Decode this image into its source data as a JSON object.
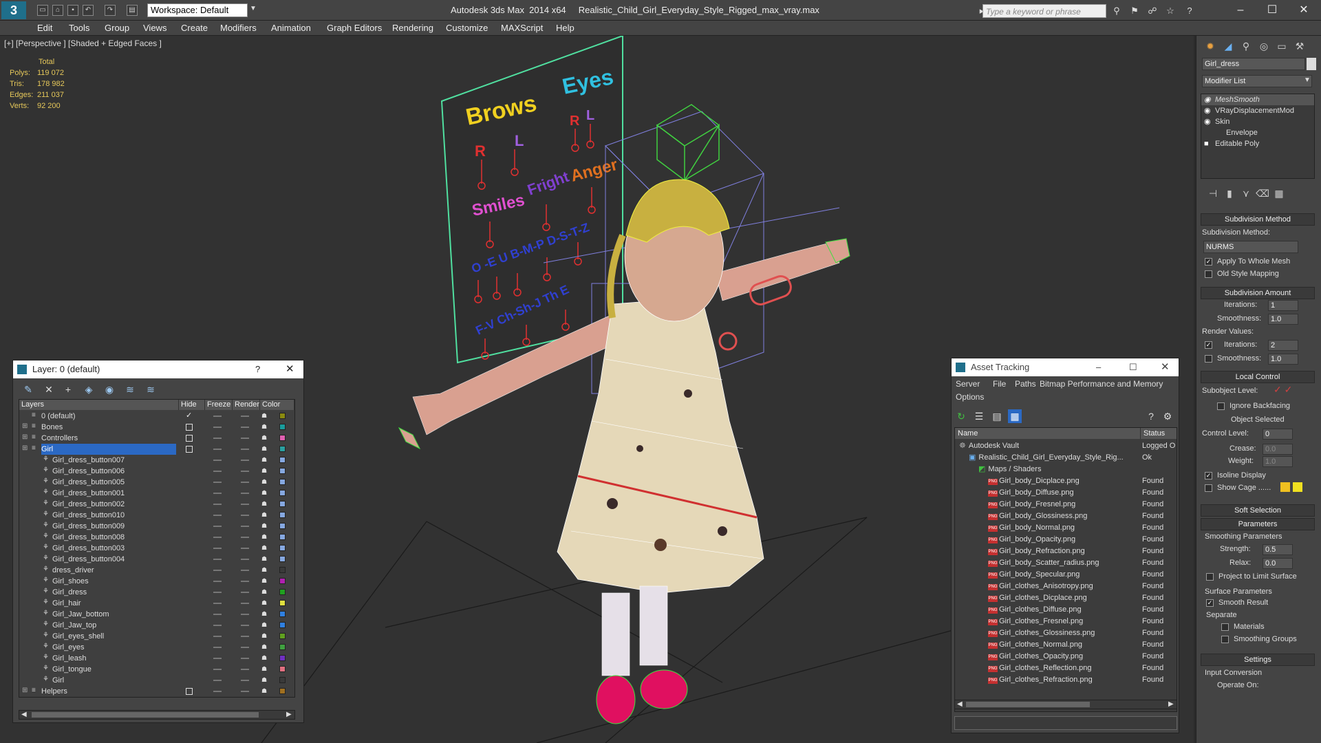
{
  "titlebar": {
    "app_logo": "3",
    "workspace": "Workspace: Default",
    "app_name": "Autodesk 3ds Max  2014 x64",
    "file_name": "Realistic_Child_Girl_Everyday_Style_Rigged_max_vray.max",
    "search_placeholder": "Type a keyword or phrase"
  },
  "menu": [
    "Edit",
    "Tools",
    "Group",
    "Views",
    "Create",
    "Modifiers",
    "Animation",
    "Graph Editors",
    "Rendering",
    "Customize",
    "MAXScript",
    "Help"
  ],
  "viewport": {
    "label": "[+] [Perspective ] [Shaded + Edged Faces ]",
    "stats_header": "Total",
    "stats": [
      {
        "label": "Polys:",
        "value": "119 072"
      },
      {
        "label": "Tris:",
        "value": "178 982"
      },
      {
        "label": "Edges:",
        "value": "211 037"
      },
      {
        "label": "Verts:",
        "value": "92 200"
      }
    ],
    "board_labels": {
      "brows": "Brows",
      "eyes": "Eyes",
      "r": "R",
      "l": "L",
      "smiles": "Smiles",
      "fright": "Fright",
      "anger": "Anger",
      "phonemes": "O  -E  U  B-M-P  D-S-T-Z",
      "phonemes2": "F-V  Ch-Sh-J  Th  E"
    }
  },
  "command_panel": {
    "object_name": "Girl_dress",
    "modifier_list": "Modifier List",
    "stack": [
      {
        "label": "MeshSmooth",
        "selected": true
      },
      {
        "label": "VRayDisplacementMod",
        "selected": false
      },
      {
        "label": "Skin",
        "selected": false
      },
      {
        "label": "Envelope",
        "selected": false
      },
      {
        "label": "Editable Poly",
        "selected": false
      }
    ],
    "subdivision_method_head": "Subdivision Method",
    "subdivision_method_label": "Subdivision Method:",
    "subdivision_method_value": "NURMS",
    "apply_whole_mesh": "Apply To Whole Mesh",
    "old_style_mapping": "Old Style Mapping",
    "subdivision_amount_head": "Subdivision Amount",
    "iterations_label": "Iterations:",
    "iterations_value": "1",
    "smoothness_label": "Smoothness:",
    "smoothness_value": "1.0",
    "render_values": "Render Values:",
    "render_iterations_label": "Iterations:",
    "render_iterations_value": "2",
    "render_smoothness_label": "Smoothness:",
    "render_smoothness_value": "1.0",
    "local_control_head": "Local Control",
    "subobject_level": "Subobject Level:",
    "ignore_backfacing": "Ignore Backfacing",
    "object_selected": "Object Selected",
    "control_level_label": "Control Level:",
    "control_level_value": "0",
    "crease_label": "Crease:",
    "crease_value": "0.0",
    "weight_label": "Weight:",
    "weight_value": "1.0",
    "isoline_display": "Isoline Display",
    "show_cage": "Show Cage ......",
    "soft_selection_head": "Soft Selection",
    "parameters_head": "Parameters",
    "smoothing_params": "Smoothing Parameters",
    "strength_label": "Strength:",
    "strength_value": "0.5",
    "relax_label": "Relax:",
    "relax_value": "0.0",
    "project_limit": "Project to Limit Surface",
    "surface_params": "Surface Parameters",
    "smooth_result": "Smooth Result",
    "separate": "Separate",
    "materials": "Materials",
    "smoothing_groups": "Smoothing Groups",
    "settings_head": "Settings",
    "input_conversion": "Input Conversion",
    "operate_on": "Operate On:"
  },
  "layer_dialog": {
    "title": "Layer: 0 (default)",
    "help": "?",
    "columns": [
      "Layers",
      "Hide",
      "Freeze",
      "Render",
      "Color"
    ],
    "rows": [
      {
        "name": "0 (default)",
        "level": 0,
        "check": true,
        "color": "#8a8a10"
      },
      {
        "name": "Bones",
        "level": 0,
        "expand": true,
        "box": true,
        "color": "#1a9c9c"
      },
      {
        "name": "Controllers",
        "level": 0,
        "expand": true,
        "box": true,
        "color": "#e060b0"
      },
      {
        "name": "Girl",
        "level": 0,
        "expand": true,
        "box": true,
        "selected": true,
        "color": "#2aa0a0"
      },
      {
        "name": "Girl_dress_button007",
        "level": 1,
        "color": "#86a8e0"
      },
      {
        "name": "Girl_dress_button006",
        "level": 1,
        "color": "#86a8e0"
      },
      {
        "name": "Girl_dress_button005",
        "level": 1,
        "color": "#86a8e0"
      },
      {
        "name": "Girl_dress_button001",
        "level": 1,
        "color": "#86a8e0"
      },
      {
        "name": "Girl_dress_button002",
        "level": 1,
        "color": "#86a8e0"
      },
      {
        "name": "Girl_dress_button010",
        "level": 1,
        "color": "#86a8e0"
      },
      {
        "name": "Girl_dress_button009",
        "level": 1,
        "color": "#86a8e0"
      },
      {
        "name": "Girl_dress_button008",
        "level": 1,
        "color": "#86a8e0"
      },
      {
        "name": "Girl_dress_button003",
        "level": 1,
        "color": "#86a8e0"
      },
      {
        "name": "Girl_dress_button004",
        "level": 1,
        "color": "#86a8e0"
      },
      {
        "name": "dress_driver",
        "level": 1,
        "color": "#3a3a3a"
      },
      {
        "name": "Girl_shoes",
        "level": 1,
        "color": "#b020b0"
      },
      {
        "name": "Girl_dress",
        "level": 1,
        "color": "#20a020"
      },
      {
        "name": "Girl_hair",
        "level": 1,
        "color": "#e0e040"
      },
      {
        "name": "Girl_Jaw_bottom",
        "level": 1,
        "color": "#3080e0"
      },
      {
        "name": "Girl_Jaw_top",
        "level": 1,
        "color": "#3080e0"
      },
      {
        "name": "Girl_eyes_shell",
        "level": 1,
        "color": "#60a020"
      },
      {
        "name": "Girl_eyes",
        "level": 1,
        "color": "#40a040"
      },
      {
        "name": "Girl_leash",
        "level": 1,
        "color": "#7030c0"
      },
      {
        "name": "Girl_tongue",
        "level": 1,
        "color": "#e07080"
      },
      {
        "name": "Girl",
        "level": 1,
        "color": "#3a3a3a"
      },
      {
        "name": "Helpers",
        "level": 0,
        "expand": true,
        "box": true,
        "color": "#a07020"
      }
    ]
  },
  "asset_dialog": {
    "title": "Asset Tracking",
    "menu_row1": [
      "Server",
      "File",
      "Paths",
      "Bitmap Performance and Memory"
    ],
    "menu_row2": [
      "Options"
    ],
    "columns": [
      "Name",
      "Status"
    ],
    "rows": [
      {
        "name": "Autodesk Vault",
        "status": "Logged O",
        "indent": 0,
        "kind": "vault"
      },
      {
        "name": "Realistic_Child_Girl_Everyday_Style_Rig...",
        "status": "Ok",
        "indent": 1,
        "kind": "max"
      },
      {
        "name": "Maps / Shaders",
        "status": "",
        "indent": 2,
        "kind": "folder"
      },
      {
        "name": "Girl_body_Dicplace.png",
        "status": "Found",
        "indent": 3,
        "kind": "png"
      },
      {
        "name": "Girl_body_Diffuse.png",
        "status": "Found",
        "indent": 3,
        "kind": "png"
      },
      {
        "name": "Girl_body_Fresnel.png",
        "status": "Found",
        "indent": 3,
        "kind": "png"
      },
      {
        "name": "Girl_body_Glossiness.png",
        "status": "Found",
        "indent": 3,
        "kind": "png"
      },
      {
        "name": "Girl_body_Normal.png",
        "status": "Found",
        "indent": 3,
        "kind": "png"
      },
      {
        "name": "Girl_body_Opacity.png",
        "status": "Found",
        "indent": 3,
        "kind": "png"
      },
      {
        "name": "Girl_body_Refraction.png",
        "status": "Found",
        "indent": 3,
        "kind": "png"
      },
      {
        "name": "Girl_body_Scatter_radius.png",
        "status": "Found",
        "indent": 3,
        "kind": "png"
      },
      {
        "name": "Girl_body_Specular.png",
        "status": "Found",
        "indent": 3,
        "kind": "png"
      },
      {
        "name": "Girl_clothes_Anisotropy.png",
        "status": "Found",
        "indent": 3,
        "kind": "png"
      },
      {
        "name": "Girl_clothes_Dicplace.png",
        "status": "Found",
        "indent": 3,
        "kind": "png"
      },
      {
        "name": "Girl_clothes_Diffuse.png",
        "status": "Found",
        "indent": 3,
        "kind": "png"
      },
      {
        "name": "Girl_clothes_Fresnel.png",
        "status": "Found",
        "indent": 3,
        "kind": "png"
      },
      {
        "name": "Girl_clothes_Glossiness.png",
        "status": "Found",
        "indent": 3,
        "kind": "png"
      },
      {
        "name": "Girl_clothes_Normal.png",
        "status": "Found",
        "indent": 3,
        "kind": "png"
      },
      {
        "name": "Girl_clothes_Opacity.png",
        "status": "Found",
        "indent": 3,
        "kind": "png"
      },
      {
        "name": "Girl_clothes_Reflection.png",
        "status": "Found",
        "indent": 3,
        "kind": "png"
      },
      {
        "name": "Girl_clothes_Refraction.png",
        "status": "Found",
        "indent": 3,
        "kind": "png"
      }
    ]
  }
}
